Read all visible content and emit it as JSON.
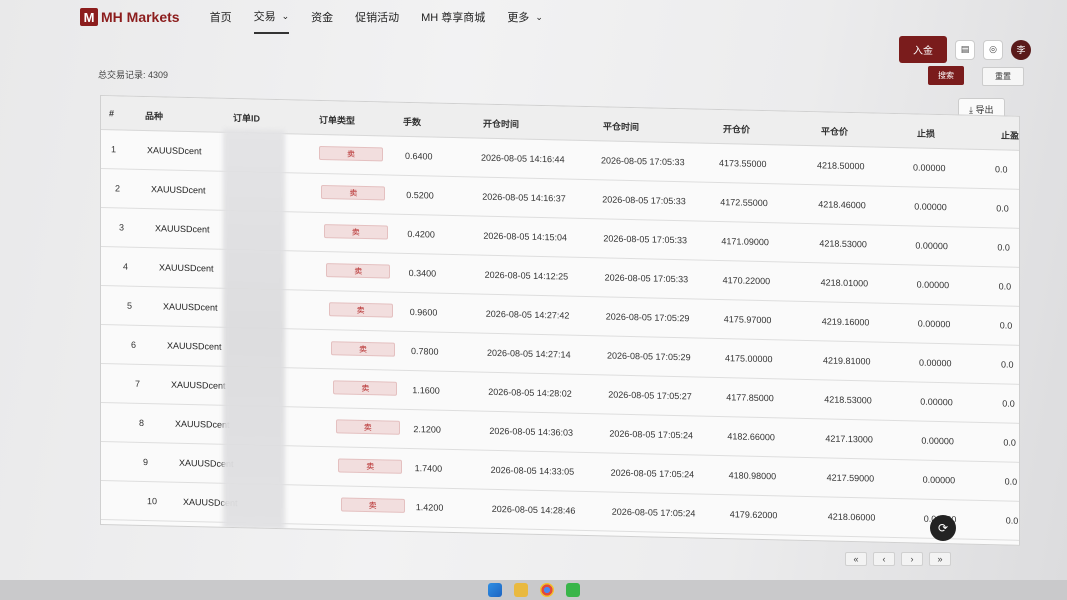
{
  "brand": {
    "logo_mark": "M",
    "name": "MH Markets"
  },
  "nav": [
    {
      "label": "首页",
      "active": false,
      "chevron": false
    },
    {
      "label": "交易",
      "active": true,
      "chevron": true
    },
    {
      "label": "资金",
      "active": false,
      "chevron": false
    },
    {
      "label": "促销活动",
      "active": false,
      "chevron": false
    },
    {
      "label": "MH 尊享商城",
      "active": false,
      "chevron": false
    },
    {
      "label": "更多",
      "active": false,
      "chevron": true
    }
  ],
  "actions": {
    "deposit_label": "入金",
    "avatar_label": "李"
  },
  "summary": {
    "total_label": "总交易记录: 4309"
  },
  "filters": {
    "search_label": "搜索",
    "reset_label": "重置",
    "export_label": "导出"
  },
  "table": {
    "columns": [
      "#",
      "品种",
      "订单ID",
      "订单类型",
      "手数",
      "开仓时间",
      "平仓时间",
      "开仓价",
      "平仓价",
      "止损",
      "止盈"
    ],
    "rows": [
      {
        "no": "1",
        "symbol": "XAUUSDcent",
        "type": "卖",
        "lots": "0.6400",
        "open_time": "2026-08-05 14:16:44",
        "close_time": "2026-08-05 17:05:33",
        "open_price": "4173.55000",
        "close_price": "4218.50000",
        "sl": "0.00000",
        "tp": "0.0"
      },
      {
        "no": "2",
        "symbol": "XAUUSDcent",
        "type": "卖",
        "lots": "0.5200",
        "open_time": "2026-08-05 14:16:37",
        "close_time": "2026-08-05 17:05:33",
        "open_price": "4172.55000",
        "close_price": "4218.46000",
        "sl": "0.00000",
        "tp": "0.0"
      },
      {
        "no": "3",
        "symbol": "XAUUSDcent",
        "type": "卖",
        "lots": "0.4200",
        "open_time": "2026-08-05 14:15:04",
        "close_time": "2026-08-05 17:05:33",
        "open_price": "4171.09000",
        "close_price": "4218.53000",
        "sl": "0.00000",
        "tp": "0.0"
      },
      {
        "no": "4",
        "symbol": "XAUUSDcent",
        "type": "卖",
        "lots": "0.3400",
        "open_time": "2026-08-05 14:12:25",
        "close_time": "2026-08-05 17:05:33",
        "open_price": "4170.22000",
        "close_price": "4218.01000",
        "sl": "0.00000",
        "tp": "0.0"
      },
      {
        "no": "5",
        "symbol": "XAUUSDcent",
        "type": "卖",
        "lots": "0.9600",
        "open_time": "2026-08-05 14:27:42",
        "close_time": "2026-08-05 17:05:29",
        "open_price": "4175.97000",
        "close_price": "4219.16000",
        "sl": "0.00000",
        "tp": "0.0"
      },
      {
        "no": "6",
        "symbol": "XAUUSDcent",
        "type": "卖",
        "lots": "0.7800",
        "open_time": "2026-08-05 14:27:14",
        "close_time": "2026-08-05 17:05:29",
        "open_price": "4175.00000",
        "close_price": "4219.81000",
        "sl": "0.00000",
        "tp": "0.0"
      },
      {
        "no": "7",
        "symbol": "XAUUSDcent",
        "type": "卖",
        "lots": "1.1600",
        "open_time": "2026-08-05 14:28:02",
        "close_time": "2026-08-05 17:05:27",
        "open_price": "4177.85000",
        "close_price": "4218.53000",
        "sl": "0.00000",
        "tp": "0.0"
      },
      {
        "no": "8",
        "symbol": "XAUUSDcent",
        "type": "卖",
        "lots": "2.1200",
        "open_time": "2026-08-05 14:36:03",
        "close_time": "2026-08-05 17:05:24",
        "open_price": "4182.66000",
        "close_price": "4217.13000",
        "sl": "0.00000",
        "tp": "0.0"
      },
      {
        "no": "9",
        "symbol": "XAUUSDcent",
        "type": "卖",
        "lots": "1.7400",
        "open_time": "2026-08-05 14:33:05",
        "close_time": "2026-08-05 17:05:24",
        "open_price": "4180.98000",
        "close_price": "4217.59000",
        "sl": "0.00000",
        "tp": "0.0"
      },
      {
        "no": "10",
        "symbol": "XAUUSDcent",
        "type": "卖",
        "lots": "1.4200",
        "open_time": "2026-08-05 14:28:46",
        "close_time": "2026-08-05 17:05:24",
        "open_price": "4179.62000",
        "close_price": "4218.06000",
        "sl": "0.00000",
        "tp": "0.0"
      }
    ]
  },
  "pager": {
    "first": "«",
    "prev": "‹",
    "next": "›",
    "last": "»"
  },
  "colors": {
    "brand": "#8c1d1d",
    "sell_badge_bg": "#f2dede",
    "sell_badge_text": "#b52b2b"
  }
}
